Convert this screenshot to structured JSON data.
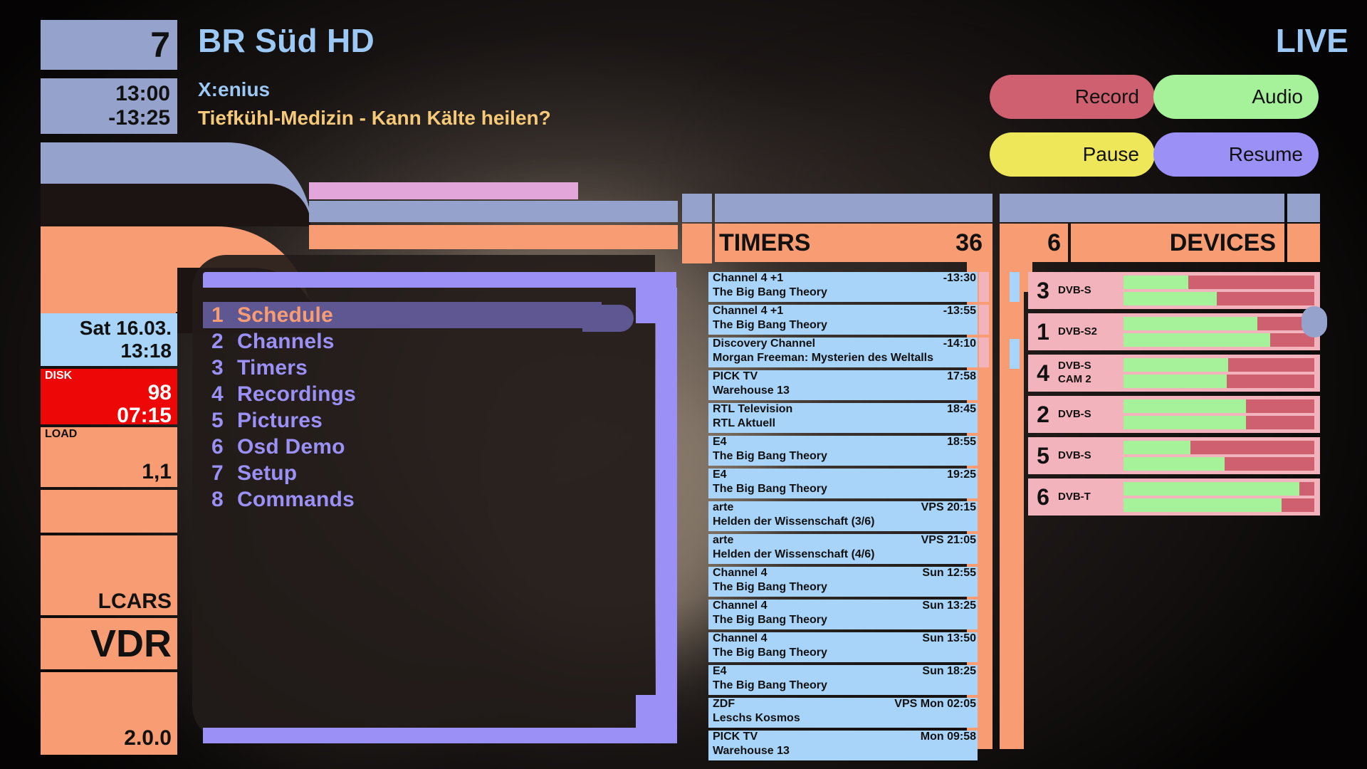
{
  "channel": {
    "number": "7",
    "name": "BR Süd HD",
    "start_time": "13:00",
    "end_time": "-13:25",
    "program_title": "X:enius",
    "program_subtitle": "Tiefkühl-Medizin - Kann Kälte heilen?",
    "live_label": "LIVE"
  },
  "color_buttons": [
    {
      "label": "Record",
      "color": "#CE6070"
    },
    {
      "label": "Audio",
      "color": "#A6F29B"
    },
    {
      "label": "Pause",
      "color": "#EDE759"
    },
    {
      "label": "Resume",
      "color": "#9B90F5"
    }
  ],
  "status": {
    "date": "Sat 16.03.",
    "time": "13:18",
    "disk_key": "DISK",
    "disk_percent": "98",
    "disk_free": "07:15",
    "load_key": "LOAD",
    "load_value": "1,1",
    "brand_lcars": "LCARS",
    "brand_vdr": "VDR",
    "version": "2.0.0"
  },
  "menu": {
    "items": [
      {
        "num": "1",
        "label": "Schedule",
        "selected": true
      },
      {
        "num": "2",
        "label": "Channels",
        "selected": false
      },
      {
        "num": "3",
        "label": "Timers",
        "selected": false
      },
      {
        "num": "4",
        "label": "Recordings",
        "selected": false
      },
      {
        "num": "5",
        "label": "Pictures",
        "selected": false
      },
      {
        "num": "6",
        "label": "Osd Demo",
        "selected": false
      },
      {
        "num": "7",
        "label": "Setup",
        "selected": false
      },
      {
        "num": "8",
        "label": "Commands",
        "selected": false
      }
    ]
  },
  "timers": {
    "title": "TIMERS",
    "count": "36",
    "entries": [
      {
        "channel": "Channel 4 +1",
        "time": "-13:30",
        "title": "The Big Bang Theory",
        "recording": true
      },
      {
        "channel": "Channel 4 +1",
        "time": "-13:55",
        "title": "The Big Bang Theory",
        "recording": true
      },
      {
        "channel": "Discovery Channel",
        "time": "-14:10",
        "title": "Morgan Freeman: Mysterien des Weltalls",
        "recording": true
      },
      {
        "channel": "PICK TV",
        "time": "17:58",
        "title": "Warehouse 13",
        "recording": false
      },
      {
        "channel": "RTL Television",
        "time": "18:45",
        "title": "RTL Aktuell",
        "recording": false
      },
      {
        "channel": "E4",
        "time": "18:55",
        "title": "The Big Bang Theory",
        "recording": false
      },
      {
        "channel": "E4",
        "time": "19:25",
        "title": "The Big Bang Theory",
        "recording": false
      },
      {
        "channel": "arte",
        "time": "VPS 20:15",
        "title": "Helden der Wissenschaft (3/6)",
        "recording": false
      },
      {
        "channel": "arte",
        "time": "VPS 21:05",
        "title": "Helden der Wissenschaft (4/6)",
        "recording": false
      },
      {
        "channel": "Channel 4",
        "time": "Sun 12:55",
        "title": "The Big Bang Theory",
        "recording": false
      },
      {
        "channel": "Channel 4",
        "time": "Sun 13:25",
        "title": "The Big Bang Theory",
        "recording": false
      },
      {
        "channel": "Channel 4",
        "time": "Sun 13:50",
        "title": "The Big Bang Theory",
        "recording": false
      },
      {
        "channel": "E4",
        "time": "Sun 18:25",
        "title": "The Big Bang Theory",
        "recording": false
      },
      {
        "channel": "ZDF",
        "time": "VPS Mon 02:05",
        "title": "Leschs Kosmos",
        "recording": false
      },
      {
        "channel": "PICK TV",
        "time": "Mon 09:58",
        "title": "Warehouse 13",
        "recording": false
      }
    ]
  },
  "devices": {
    "title": "DEVICES",
    "count": "6",
    "entries": [
      {
        "num": "3",
        "type": "DVB-S",
        "cam": "",
        "signal": 34,
        "quality": 49
      },
      {
        "num": "1",
        "type": "DVB-S2",
        "cam": "",
        "signal": 70,
        "quality": 77
      },
      {
        "num": "4",
        "type": "DVB-S",
        "cam": "CAM 2",
        "signal": 55,
        "quality": 54
      },
      {
        "num": "2",
        "type": "DVB-S",
        "cam": "",
        "signal": 64,
        "quality": 64
      },
      {
        "num": "5",
        "type": "DVB-S",
        "cam": "",
        "signal": 35,
        "quality": 53
      },
      {
        "num": "6",
        "type": "DVB-T",
        "cam": "",
        "signal": 92,
        "quality": 83
      }
    ]
  },
  "colors": {
    "orange": "#F79C73",
    "blue_grey": "#94A2CC",
    "light_blue": "#A8D4FA",
    "purple": "#9B90F5",
    "pink": "#F2B3BC",
    "green": "#A6F29B",
    "rose": "#CE6070",
    "yellow": "#EDE759",
    "red": "#ED0707"
  }
}
